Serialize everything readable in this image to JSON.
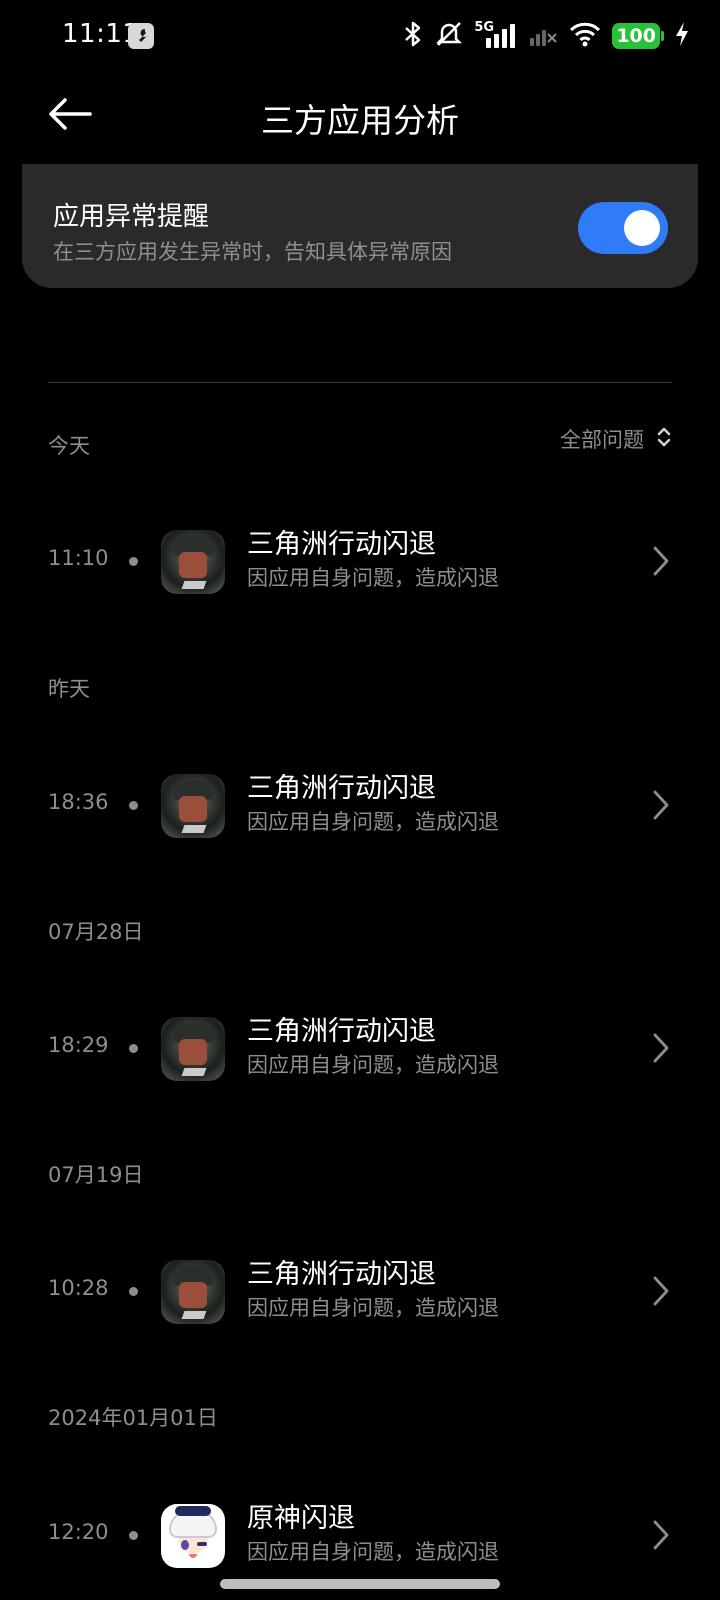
{
  "status_bar": {
    "time": "11:11",
    "network": "5G",
    "battery": "100",
    "colors": {
      "battery": "#27c23a"
    },
    "icons": [
      "wrench-icon",
      "bluetooth-icon",
      "mute-icon",
      "signal-icon",
      "signal-icon-no-service",
      "wifi-icon",
      "battery-icon",
      "charging-icon"
    ]
  },
  "header": {
    "title": "三方应用分析",
    "back_icon": "back-arrow-icon"
  },
  "alert_card": {
    "title": "应用异常提醒",
    "subtitle": "在三方应用发生异常时，告知具体异常原因",
    "toggle_on": true,
    "colors": {
      "toggle": "#2f7cf6",
      "card": "#2a2a2a"
    }
  },
  "filter": {
    "label": "全部问题",
    "icon": "sort-updown-icon"
  },
  "groups": [
    {
      "date": "今天",
      "records": [
        {
          "time": "11:10",
          "app_icon": "delta-force-icon",
          "title": "三角洲行动闪退",
          "subtitle": "因应用自身问题，造成闪退"
        }
      ]
    },
    {
      "date": "昨天",
      "records": [
        {
          "time": "18:36",
          "app_icon": "delta-force-icon",
          "title": "三角洲行动闪退",
          "subtitle": "因应用自身问题，造成闪退"
        }
      ]
    },
    {
      "date": "07月28日",
      "records": [
        {
          "time": "18:29",
          "app_icon": "delta-force-icon",
          "title": "三角洲行动闪退",
          "subtitle": "因应用自身问题，造成闪退"
        }
      ]
    },
    {
      "date": "07月19日",
      "records": [
        {
          "time": "10:28",
          "app_icon": "delta-force-icon",
          "title": "三角洲行动闪退",
          "subtitle": "因应用自身问题，造成闪退"
        }
      ]
    },
    {
      "date": "2024年01月01日",
      "records": [
        {
          "time": "12:20",
          "app_icon": "genshin-impact-icon",
          "title": "原神闪退",
          "subtitle": "因应用自身问题，造成闪退"
        }
      ]
    }
  ]
}
